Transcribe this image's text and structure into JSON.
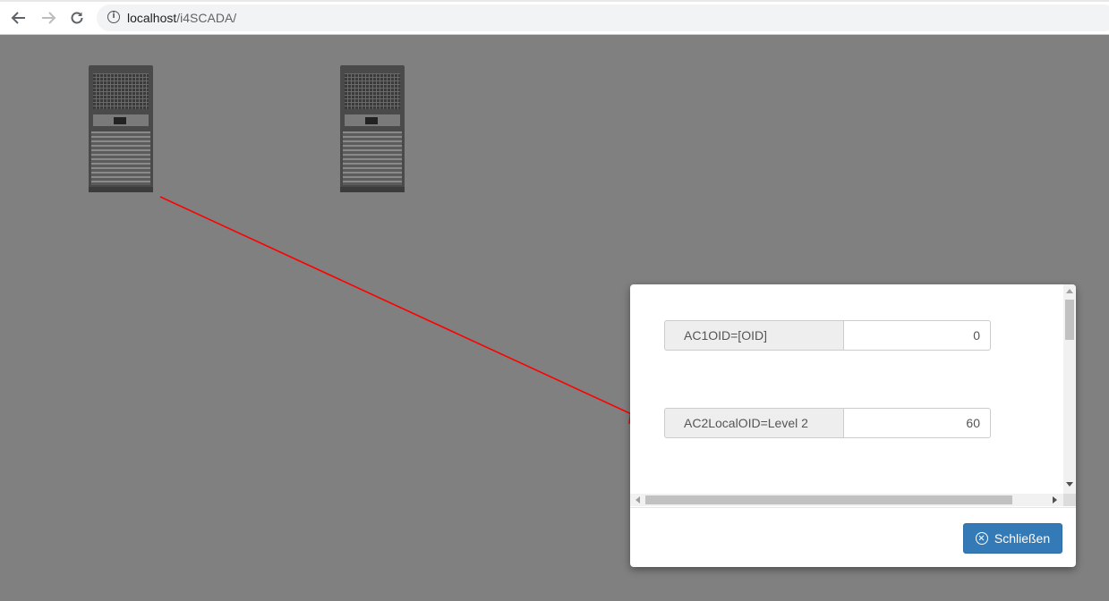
{
  "browser": {
    "url_host": "localhost",
    "url_path": "/i4SCADA/",
    "back_icon": "arrow-left-icon",
    "forward_icon": "arrow-right-icon",
    "reload_icon": "reload-icon",
    "info_icon": "info-icon"
  },
  "canvas": {
    "background": "#808080",
    "arrow_color": "#ff0000",
    "units": [
      "ac-unit-1",
      "ac-unit-2"
    ]
  },
  "dialog": {
    "fields": [
      {
        "label": "AC1OID=[OID]",
        "value": "0"
      },
      {
        "label": "AC2LocalOID=Level 2",
        "value": "60"
      }
    ],
    "close_label": "Schließen",
    "close_icon": "circle-x-icon",
    "button_color": "#337ab7"
  }
}
